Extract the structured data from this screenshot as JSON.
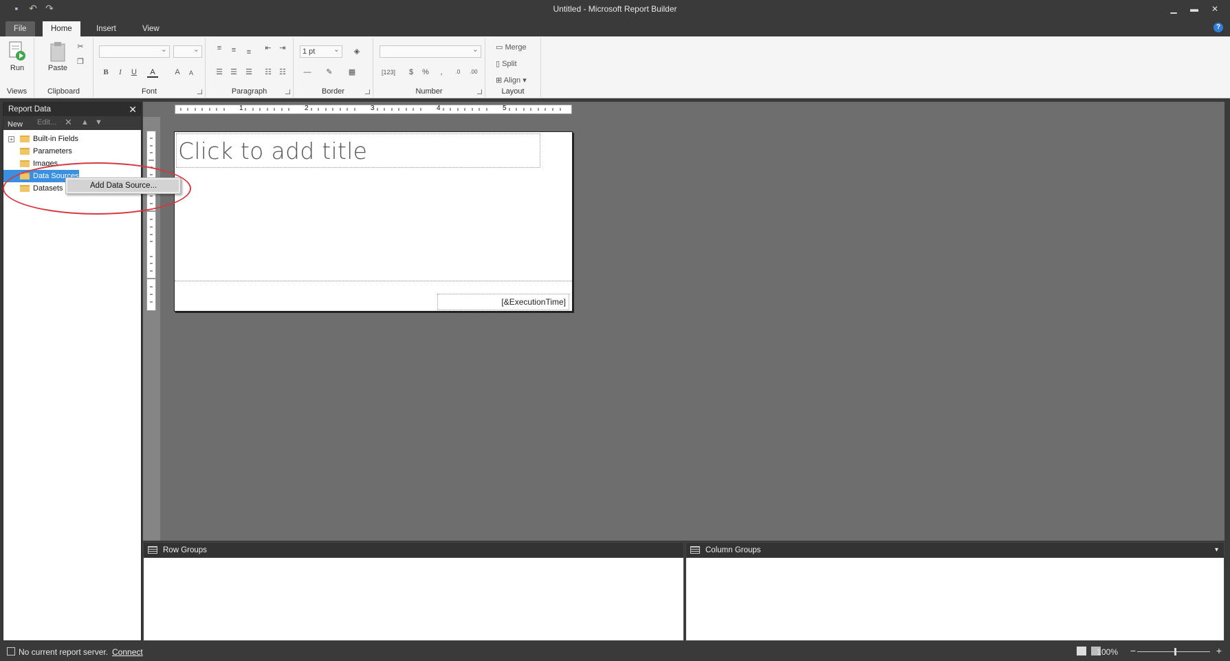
{
  "window": {
    "title": "Untitled - Microsoft Report Builder",
    "controls": [
      "minimize-icon",
      "restore-icon",
      "close-icon"
    ]
  },
  "quick_access": [
    "save-icon",
    "undo-icon",
    "redo-icon"
  ],
  "tabs": [
    {
      "label": "File"
    },
    {
      "label": "Home",
      "active": true
    },
    {
      "label": "Insert"
    },
    {
      "label": "View"
    }
  ],
  "ribbon": {
    "views": {
      "label": "Views",
      "run": "Run"
    },
    "clipboard": {
      "label": "Clipboard",
      "paste": "Paste"
    },
    "font": {
      "label": "Font",
      "bold": "B",
      "italic": "I",
      "underline": "U",
      "color": "A",
      "grow": "A",
      "shrink": "A"
    },
    "paragraph": {
      "label": "Paragraph"
    },
    "border": {
      "label": "Border",
      "width": "1 pt"
    },
    "number": {
      "label": "Number",
      "placeholder": "[123]",
      "currency": "$",
      "percent": "%",
      "comma": ",",
      "inc": ".0",
      "dec": ".00"
    },
    "layout": {
      "label": "Layout",
      "merge": "Merge",
      "split": "Split",
      "align": "Align"
    }
  },
  "report_data": {
    "title": "Report Data",
    "toolbar": {
      "new": "New",
      "edit": "Edit..."
    },
    "tree": [
      {
        "label": "Built-in Fields",
        "expandable": true
      },
      {
        "label": "Parameters"
      },
      {
        "label": "Images"
      },
      {
        "label": "Data Sources",
        "selected": true
      },
      {
        "label": "Datasets"
      }
    ]
  },
  "context_menu": {
    "items": [
      "Add Data Source..."
    ]
  },
  "ruler": {
    "marks": [
      "1",
      "2",
      "3",
      "4",
      "5"
    ]
  },
  "report": {
    "title_placeholder": "Click to add title",
    "footer_expression": "[&ExecutionTime]"
  },
  "groups": {
    "row": "Row Groups",
    "column": "Column Groups"
  },
  "status": {
    "message": "No current report server.",
    "connect": "Connect",
    "zoom": "100%"
  },
  "colors": {
    "accent": "#3b8fe0",
    "highlight_ring": "#d9363e",
    "chrome": "#3a3a3a"
  }
}
